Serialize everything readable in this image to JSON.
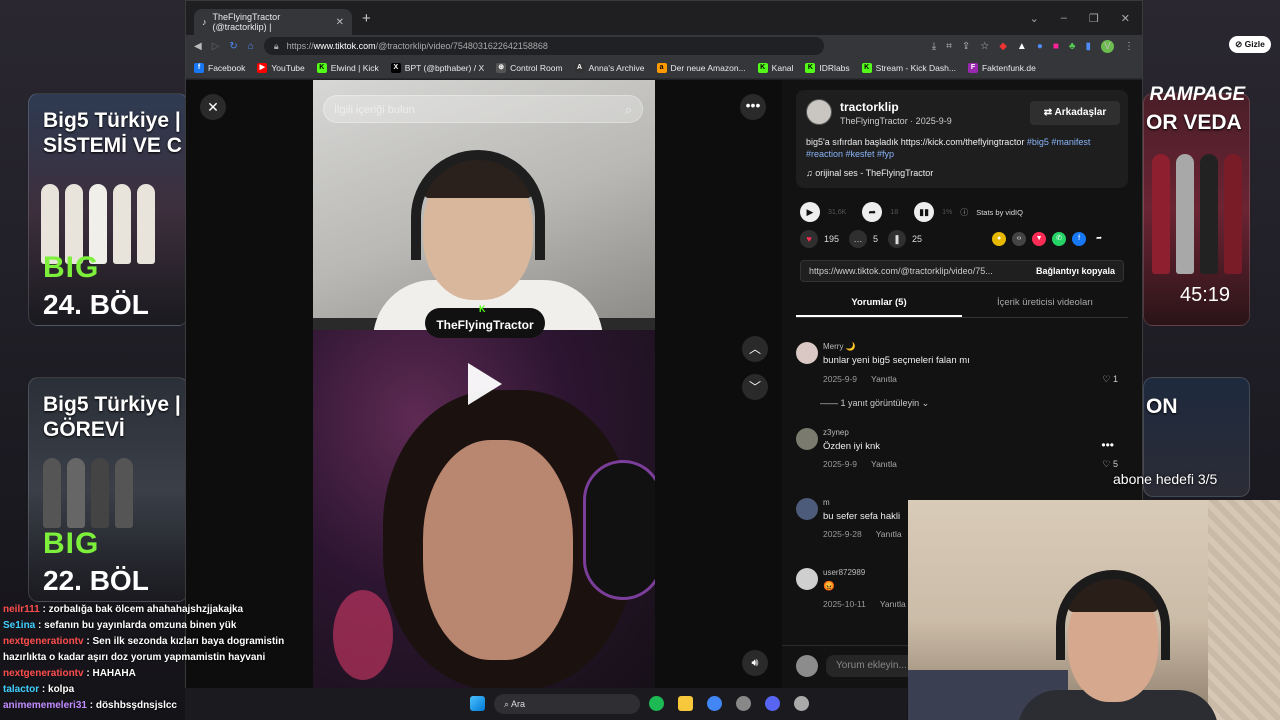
{
  "browser": {
    "tab_title": "TheFlyingTractor (@tractorklip) |",
    "url_prefix": "https://",
    "url_domain": "www.tiktok.com",
    "url_path": "/@tractorklip/video/7548031622642158868",
    "bookmarks": [
      {
        "label": "Facebook",
        "color": "#1877f2",
        "glyph": "f"
      },
      {
        "label": "YouTube",
        "color": "#ff0000",
        "glyph": "▶"
      },
      {
        "label": "Elwind | Kick",
        "color": "#53fc18",
        "glyph": "K"
      },
      {
        "label": "BPT (@bpthaber) / X",
        "color": "#000000",
        "glyph": "X"
      },
      {
        "label": "Control Room",
        "color": "#555555",
        "glyph": "⊕"
      },
      {
        "label": "Anna's Archive",
        "color": "#333333",
        "glyph": "A"
      },
      {
        "label": "Der neue Amazon...",
        "color": "#ff9900",
        "glyph": "a"
      },
      {
        "label": "Kanal",
        "color": "#53fc18",
        "glyph": "K"
      },
      {
        "label": "IDRlabs",
        "color": "#53fc18",
        "glyph": "K"
      },
      {
        "label": "Stream - Kick Dash...",
        "color": "#53fc18",
        "glyph": "K"
      },
      {
        "label": "Faktenfunk.de",
        "color": "#9c27b0",
        "glyph": "F"
      }
    ]
  },
  "video": {
    "search_placeholder": "İlgili içeriği bulun",
    "streamer_label": "TheFlyingTractor"
  },
  "post": {
    "author": "tractorklip",
    "author_sub": "TheFlyingTractor · 2025-9-9",
    "follow_label": "Arkadaşlar",
    "desc_text": "big5'a sıfırdan başladık https://kick.com/theflyingtractor ",
    "tags_line1": "#big5 #manifest",
    "tags_line2": "#reaction #kesfet #fyp",
    "music": "orijinal ses - TheFlyingTractor",
    "plays": "31,6K",
    "shares_small": "18",
    "pct": "1%",
    "stats_label": "Stats by vidIQ",
    "likes": "195",
    "comments": "5",
    "saves": "25",
    "link": "https://www.tiktok.com/@tractorklip/video/75...",
    "copy_label": "Bağlantıyı kopyala",
    "tab_comments": "Yorumlar (5)",
    "tab_creator": "İçerik üreticisi videoları",
    "add_comment_placeholder": "Yorum ekleyin..."
  },
  "comments": [
    {
      "name": "Merry 🌙",
      "text": "bunlar yeni big5 seçmeleri falan mı",
      "date": "2025-9-9",
      "reply": "Yanıtla",
      "likes": "1"
    },
    {
      "name": "z3ynep",
      "text": "Özden iyi knk",
      "date": "2025-9-9",
      "reply": "Yanıtla",
      "likes": "5"
    },
    {
      "name": "m",
      "text": "bu sefer sefa hakli",
      "date": "2025-9-28",
      "reply": "Yanıtla",
      "likes": ""
    },
    {
      "name": "user872989",
      "text": "😡",
      "date": "2025-10-11",
      "reply": "Yanıtla",
      "likes": ""
    }
  ],
  "replies_label": "1 yanıt görüntüleyin",
  "background": {
    "card1_title": "Big5 Türkiye | SİSTEMİ VE C",
    "card1_big": "BIG",
    "card1_bol": "24. BÖL",
    "card2_title": "Big5 Türkiye | GÖREVİ",
    "card2_big": "BIG",
    "card2_bol": "22. BÖL",
    "card3_title": "OR VEDA",
    "card4_title": "ON",
    "timer": "45:19"
  },
  "overlay": {
    "rampage": "RAMPAGE",
    "gizle": "Gizle",
    "goal": "abone hedefi 3/5"
  },
  "chat": [
    {
      "user": "neilr111",
      "color": "#ff4d4d",
      "msg": "zorbalığa bak ölcem ahahahajshzjjakajka"
    },
    {
      "user": "Se1ina",
      "color": "#3fd0ff",
      "msg": "sefanın bu yayınlarda omzuna binen yük"
    },
    {
      "user": "nextgenerationtv",
      "color": "#ff4d4d",
      "msg": "Sen ilk sezonda kızları baya dogramistin"
    },
    {
      "user": "",
      "color": "#ffffff",
      "msg": "hazırlıkta o kadar aşırı doz yorum yapmamistin hayvani"
    },
    {
      "user": "nextgenerationtv",
      "color": "#ff4d4d",
      "msg": "HAHAHA"
    },
    {
      "user": "talactor",
      "color": "#3fd0ff",
      "msg": "kolpa"
    },
    {
      "user": "animememeleri31",
      "color": "#c18cff",
      "msg": "döshbsşdnsjslcc"
    }
  ],
  "taskbar": {
    "search": "Ara"
  }
}
